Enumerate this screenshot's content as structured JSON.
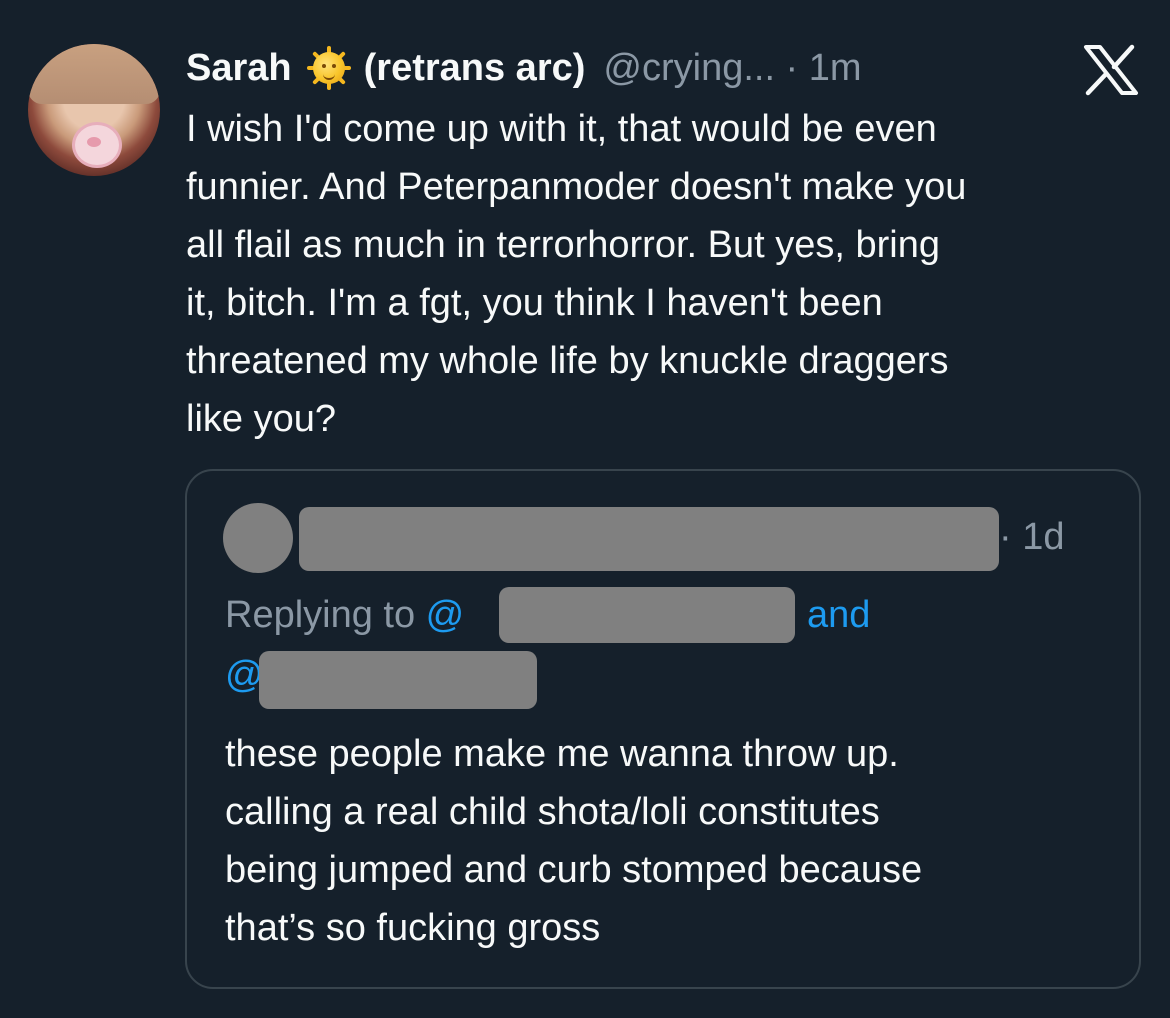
{
  "tweet": {
    "author_name": "Sarah",
    "emoji_icon": "sun-with-face-icon",
    "name_suffix": "(retrans arc)",
    "handle_time": "@crying... · 1m",
    "platform_icon": "x-logo-icon",
    "text": "I wish I'd come up with it, that would be even\nfunnier. And Peterpanmoder doesn't make you\nall flail as much in terrorhorror. But yes, bring\nit, bitch. I'm a fgt, you think I haven't been\nthreatened my whole life by knuckle draggers\nlike you?"
  },
  "quoted": {
    "time": "· 1d",
    "replying_prefix": "Replying to ",
    "at_sign": "@",
    "and_label": "and",
    "text": "these people make me wanna throw up.\ncalling a real child shota/loli constitutes\nbeing jumped and curb stomped because\nthat’s so fucking gross"
  },
  "colors": {
    "background": "#15202b",
    "text": "#f7f9f9",
    "muted": "#8b98a5",
    "link": "#1d9bf0",
    "redaction": "#808080",
    "border": "#38444d"
  }
}
